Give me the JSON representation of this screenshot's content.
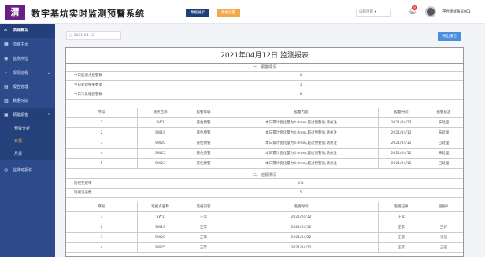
{
  "header": {
    "logo": "渭",
    "title": "数字基坑实时监测预警系统",
    "btn_primary": "数据展示",
    "btn_secondary": "系统设置",
    "search": "选择项目",
    "notif_count": "9",
    "user": "平台测试账号001"
  },
  "sidebar": {
    "section": "项目概况",
    "items": [
      "项目主页",
      "监测点位",
      "现场巡视",
      "报告管理",
      "数据对比",
      "预警报告",
      "监测可视化"
    ],
    "sub_items": [
      "预警分析",
      "日报",
      "月报"
    ]
  },
  "toolbar": {
    "date": "2021-04-12",
    "export": "导出报告"
  },
  "report": {
    "title": "2021年04月12日 监测报表",
    "section1": "一、报警情况",
    "summary1": [
      {
        "label": "今日监测点报警数",
        "value": "1"
      },
      {
        "label": "今日处理报警数量",
        "value": "1"
      },
      {
        "label": "今日未处理报警数",
        "value": "0"
      }
    ],
    "alarm_cols": [
      "序号",
      "测点名称",
      "报警等级",
      "报警内容",
      "报警时间",
      "报警状态"
    ],
    "alarm_rows": [
      [
        "1",
        "SW1",
        "黄色预警",
        "本日累计变化量为4.0mm,超过预警值,请关注",
        "2021/04/12",
        "未处理"
      ],
      [
        "2",
        "SW19",
        "黄色预警",
        "本日累计变化量为4.0mm,超过预警值,请关注",
        "2021/04/12",
        "未处理"
      ],
      [
        "3",
        "SW20",
        "黄色预警",
        "本日累计变化量为4.0mm,超过预警值,请关注",
        "2021/04/12",
        "已处理"
      ],
      [
        "4",
        "SW25",
        "黄色预警",
        "本日累计变化量为4.0mm,超过预警值,请关注",
        "2021/04/12",
        "未处理"
      ],
      [
        "5",
        "SW23",
        "黄色预警",
        "本日累计变化量为4.0mm,超过预警值,请关注",
        "2021/04/12",
        "已处理"
      ]
    ],
    "section2": "二、巡视情况",
    "summary2": [
      {
        "label": "巡视完成率",
        "value": "0%"
      },
      {
        "label": "巡视记录数",
        "value": "5"
      }
    ],
    "patrol_cols": [
      "序号",
      "巡视点名称",
      "巡视内容",
      "巡视时间",
      "巡视记录",
      "巡视人"
    ],
    "patrol_rows": [
      [
        "1",
        "SW1",
        "正常",
        "2021/04/12",
        "正常",
        ""
      ],
      [
        "2",
        "SW19",
        "正常",
        "2021/04/12",
        "正常",
        "王好"
      ],
      [
        "3",
        "SW20",
        "正常",
        "2021/04/12",
        "正常",
        "张强"
      ],
      [
        "4",
        "SW25",
        "正常",
        "2021/04/12",
        "正常",
        "王强"
      ]
    ]
  }
}
